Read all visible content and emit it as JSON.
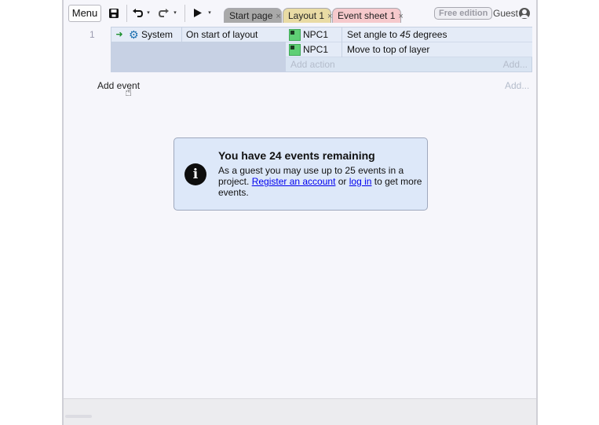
{
  "toolbar": {
    "menu_label": "Menu",
    "save_icon": "save-icon",
    "undo_icon": "undo-icon",
    "redo_icon": "redo-icon",
    "play_icon": "play-icon",
    "caret": "▾"
  },
  "tabs": [
    {
      "label": "Start page",
      "close": "×",
      "color": "#a9a9a9"
    },
    {
      "label": "Layout 1",
      "close": "×",
      "color": "#e9dba4"
    },
    {
      "label": "Event sheet 1",
      "close": "×",
      "color": "#f6c9cc"
    }
  ],
  "account": {
    "edition": "Free edition",
    "user": "Guest"
  },
  "event_sheet": {
    "events": [
      {
        "number": "1",
        "condition": {
          "object": "System",
          "text": "On start of layout"
        },
        "actions": [
          {
            "object": "NPC1",
            "text_prefix": "Set angle to ",
            "value": "45",
            "text_suffix": " degrees"
          },
          {
            "object": "NPC1",
            "text": "Move to top of layer"
          }
        ],
        "add_action_label": "Add action",
        "add_label": "Add..."
      }
    ],
    "add_event_label": "Add event",
    "add_label": "Add..."
  },
  "notice": {
    "title": "You have 24 events remaining",
    "body_1": "As a guest you may use up to 25 events in a project. ",
    "link_register": "Register an account",
    "body_2": " or ",
    "link_login": "log in",
    "body_3": " to get more events."
  }
}
